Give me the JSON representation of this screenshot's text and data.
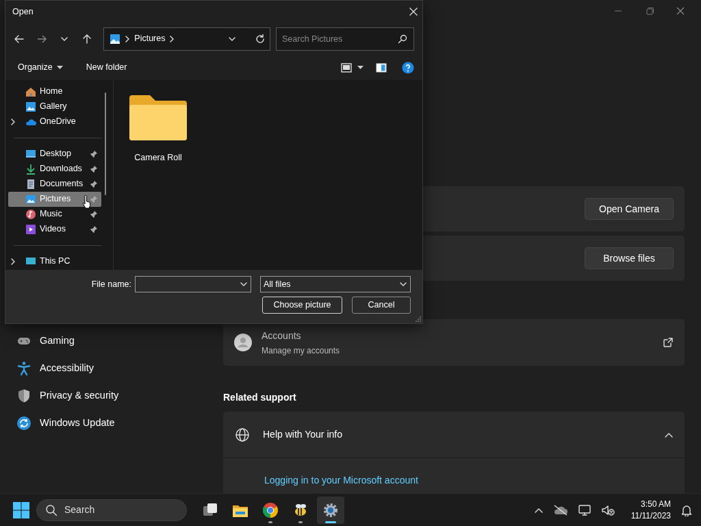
{
  "settings": {
    "nav_items": [
      {
        "label": "Gaming",
        "kind": "gaming"
      },
      {
        "label": "Accessibility",
        "kind": "accessibility"
      },
      {
        "label": "Privacy & security",
        "kind": "privacy"
      },
      {
        "label": "Windows Update",
        "kind": "update"
      }
    ],
    "cards": [
      {
        "kind": "action",
        "button": "Open Camera"
      },
      {
        "kind": "action",
        "button": "Browse files"
      },
      {
        "kind": "link",
        "title": "Accounts",
        "subtitle": "Manage my accounts"
      }
    ],
    "related_support": {
      "heading": "Related support",
      "title": "Help with Your info",
      "expanded": true,
      "links": [
        "Logging in to your Microsoft account"
      ]
    }
  },
  "dialog": {
    "title": "Open",
    "address": "Pictures",
    "search": {
      "placeholder": "Search Pictures"
    },
    "toolbar": [
      "Organize",
      "New folder"
    ],
    "nav_groups": [
      [
        {
          "label": "Home",
          "kind": "home",
          "expandable": false,
          "pinned": false,
          "selected": false
        },
        {
          "label": "Gallery",
          "kind": "gallery",
          "expandable": false,
          "pinned": false,
          "selected": false
        },
        {
          "label": "OneDrive",
          "kind": "cloud",
          "expandable": true,
          "pinned": false,
          "selected": false
        }
      ],
      [
        {
          "label": "Desktop",
          "kind": "desktop",
          "expandable": false,
          "pinned": true,
          "selected": false
        },
        {
          "label": "Downloads",
          "kind": "downloads",
          "expandable": false,
          "pinned": true,
          "selected": false
        },
        {
          "label": "Documents",
          "kind": "documents",
          "expandable": false,
          "pinned": true,
          "selected": false
        },
        {
          "label": "Pictures",
          "kind": "pictures",
          "expandable": false,
          "pinned": true,
          "selected": true
        },
        {
          "label": "Music",
          "kind": "music",
          "expandable": false,
          "pinned": true,
          "selected": false
        },
        {
          "label": "Videos",
          "kind": "videos",
          "expandable": false,
          "pinned": true,
          "selected": false
        }
      ],
      [
        {
          "label": "This PC",
          "kind": "pc",
          "expandable": true,
          "pinned": false,
          "selected": false
        }
      ]
    ],
    "items": [
      {
        "label": "Camera Roll"
      }
    ],
    "file_name_label": "File name:",
    "file_type": "All files",
    "buttons": [
      {
        "label": "Choose picture",
        "kind": "default"
      },
      {
        "label": "Cancel",
        "kind": "normal"
      }
    ]
  },
  "taskbar": {
    "search": "Search",
    "apps": [
      {
        "kind": "taskview",
        "running": false,
        "selected": false
      },
      {
        "kind": "explorer",
        "running": false,
        "selected": false
      },
      {
        "kind": "chrome",
        "running": true,
        "selected": false
      },
      {
        "kind": "bee",
        "running": true,
        "selected": false
      },
      {
        "kind": "settings",
        "running": true,
        "selected": true
      }
    ],
    "time": "3:50 AM",
    "date": "11/11/2023"
  }
}
